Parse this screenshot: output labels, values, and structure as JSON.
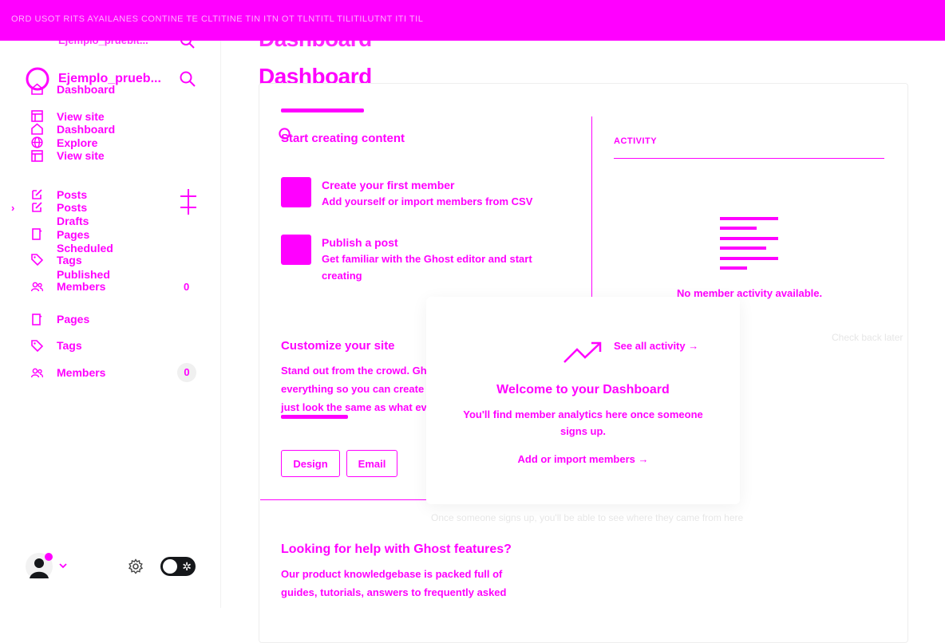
{
  "topbar": {
    "banner": "ORD USOT RITS AYAILANES     CONTINE   TE   CLTITINE   TIN ITN OT TLNTITL   TILITILUTNT   ITI TIL"
  },
  "sidebar": {
    "ghost_site_title": "Ejemplo_pruebit...",
    "site_title": "Ejemplo_prueb...",
    "ghost_items": [
      "Dashboard",
      "View site",
      "Dashboard",
      "Explore",
      "View site"
    ],
    "ghost_posts": [
      "Posts",
      "Drafts",
      "Scheduled",
      "Published"
    ],
    "ghost_misc": [
      "Posts",
      "Pages",
      "Tags",
      "Members"
    ],
    "ghost_members_count": "0",
    "nav": {
      "pages": "Pages",
      "tags": "Tags",
      "members": "Members",
      "members_count": "0"
    }
  },
  "main": {
    "ghost_heading": "Dashboard",
    "heading": "Dashboard",
    "start": {
      "title": "Start creating content",
      "item1_title": "Create your first member",
      "item1_desc": "Add yourself or import members from CSV",
      "item2_title": "Publish a post",
      "item2_desc": "Get familiar with the Ghost editor and start creating"
    },
    "customize": {
      "title": "Customize your site",
      "text": "Stand out from the crowd. Ghost lets you customize everything so you can create a publication that doesn't just look the same as what everyone else has.",
      "design_button": "Design",
      "email_button": "Email"
    },
    "activity": {
      "label": "ACTIVITY",
      "empty": "No member activity available.",
      "see_all": "See all activity →"
    },
    "help": {
      "title": "Looking for help with Ghost features?",
      "text": "Our product knowledgebase is packed full of guides, tutorials, answers to frequently asked"
    },
    "faded": {
      "right_hint": "Check back later",
      "under_modal": "Once someone signs up, you'll be able to see where they came from here"
    }
  },
  "modal": {
    "title": "Welcome to your Dashboard",
    "text": "You'll find member analytics here once someone signs up.",
    "link": "Add or import members →"
  },
  "colors": {
    "accent": "#ff00ff",
    "background": "#ffffff",
    "toggle": "#15171a"
  }
}
